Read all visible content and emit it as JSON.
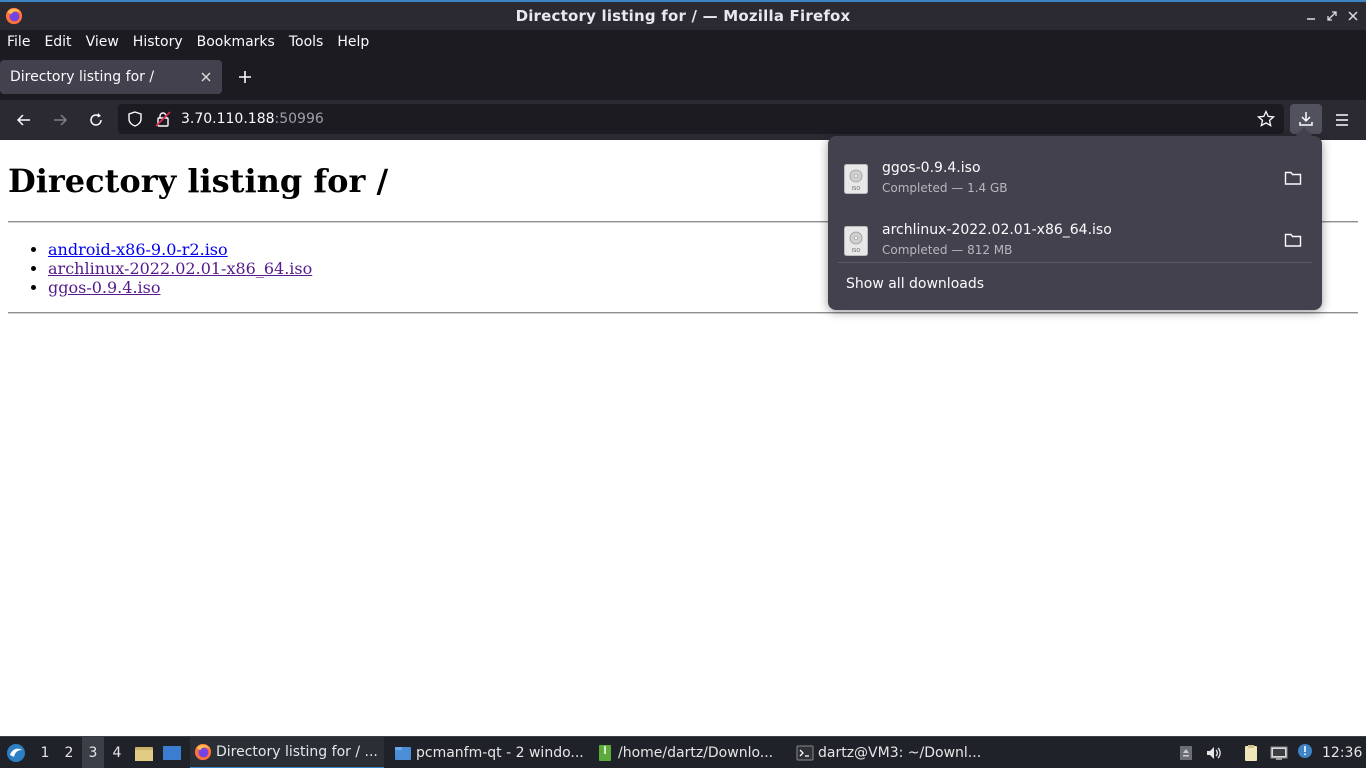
{
  "window": {
    "title": "Directory listing for / — Mozilla Firefox"
  },
  "menu": [
    "File",
    "Edit",
    "View",
    "History",
    "Bookmarks",
    "Tools",
    "Help"
  ],
  "tab": {
    "label": "Directory listing for /"
  },
  "urlbar": {
    "host": "3.70.110.188",
    "port": ":50996"
  },
  "page": {
    "heading": "Directory listing for /",
    "files": [
      "android-x86-9.0-r2.iso",
      "archlinux-2022.02.01-x86_64.iso",
      "ggos-0.9.4.iso"
    ]
  },
  "downloads": {
    "items": [
      {
        "name": "ggos-0.9.4.iso",
        "status": "Completed — 1.4 GB"
      },
      {
        "name": "archlinux-2022.02.01-x86_64.iso",
        "status": "Completed — 812 MB"
      }
    ],
    "show_all": "Show all downloads",
    "file_icon_text": "ISO"
  },
  "taskbar": {
    "workspaces": [
      "1",
      "2",
      "3",
      "4"
    ],
    "active_workspace": "3",
    "tasks": [
      {
        "label": "Directory listing for / ..."
      },
      {
        "label": "pcmanfm-qt - 2 windo..."
      },
      {
        "label": "/home/dartz/Downlo..."
      },
      {
        "label": "dartz@VM3: ~/Downl..."
      }
    ],
    "clock": "12:36"
  },
  "colors": {
    "accent": "#3d84c6",
    "chrome_dark": "#1c1b22",
    "toolbar": "#2b2a33",
    "panel": "#42414d",
    "link": "#0000ee",
    "visited_link": "#551a8b"
  }
}
